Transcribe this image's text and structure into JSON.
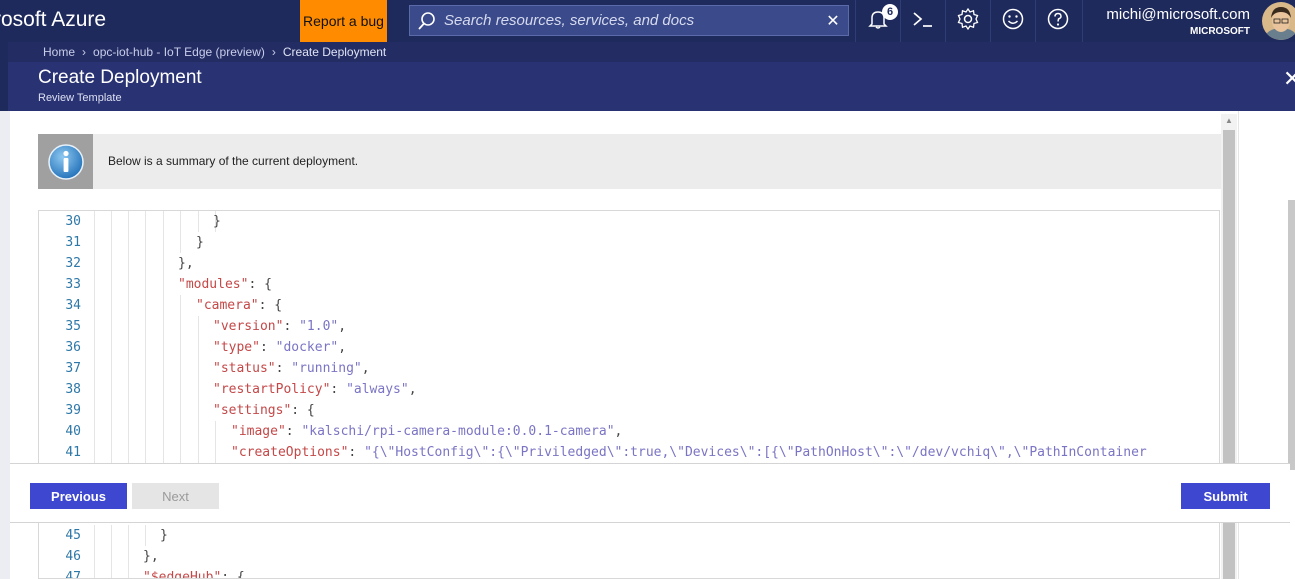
{
  "header": {
    "brand": "rosoft Azure",
    "report_bug": "Report a bug",
    "search_placeholder": "Search resources, services, and docs",
    "notifications_count": "6",
    "account_name": "michi@microsoft.com",
    "account_tenant": "MICROSOFT",
    "icons": [
      "bell-icon",
      "cloud-shell-icon",
      "gear-icon",
      "smiley-icon",
      "help-icon"
    ]
  },
  "breadcrumb": {
    "home": "Home",
    "hub": "opc-iot-hub - IoT Edge (preview)",
    "current": "Create Deployment"
  },
  "blade": {
    "title": "Create Deployment",
    "subtitle": "Review Template",
    "close": "✕"
  },
  "info": {
    "text": "Below is a summary of the current deployment."
  },
  "editor": {
    "lines": [
      {
        "n": "30",
        "parts": [
          [
            "p",
            "}"
          ]
        ]
      },
      {
        "n": "31",
        "parts": [
          [
            "p",
            "}"
          ]
        ]
      },
      {
        "n": "32",
        "parts": [
          [
            "p",
            "},"
          ]
        ]
      },
      {
        "n": "33",
        "parts": [
          [
            "k",
            "\"modules\""
          ],
          [
            "p",
            ": {"
          ]
        ]
      },
      {
        "n": "34",
        "parts": [
          [
            "k",
            "\"camera\""
          ],
          [
            "p",
            ": {"
          ]
        ]
      },
      {
        "n": "35",
        "parts": [
          [
            "k",
            "\"version\""
          ],
          [
            "p",
            ": "
          ],
          [
            "s",
            "\"1.0\""
          ],
          [
            "p",
            ","
          ]
        ]
      },
      {
        "n": "36",
        "parts": [
          [
            "k",
            "\"type\""
          ],
          [
            "p",
            ": "
          ],
          [
            "s",
            "\"docker\""
          ],
          [
            "p",
            ","
          ]
        ]
      },
      {
        "n": "37",
        "parts": [
          [
            "k",
            "\"status\""
          ],
          [
            "p",
            ": "
          ],
          [
            "s",
            "\"running\""
          ],
          [
            "p",
            ","
          ]
        ]
      },
      {
        "n": "38",
        "parts": [
          [
            "k",
            "\"restartPolicy\""
          ],
          [
            "p",
            ": "
          ],
          [
            "s",
            "\"always\""
          ],
          [
            "p",
            ","
          ]
        ]
      },
      {
        "n": "39",
        "parts": [
          [
            "k",
            "\"settings\""
          ],
          [
            "p",
            ": {"
          ]
        ]
      },
      {
        "n": "40",
        "parts": [
          [
            "k",
            "\"image\""
          ],
          [
            "p",
            ": "
          ],
          [
            "s",
            "\"kalschi/rpi-camera-module:0.0.1-camera\""
          ],
          [
            "p",
            ","
          ]
        ]
      },
      {
        "n": "41",
        "parts": [
          [
            "k",
            "\"createOptions\""
          ],
          [
            "p",
            ": "
          ],
          [
            "s",
            "\"{\\\"HostConfig\\\":{\\\"Priviledged\\\":true,\\\"Devices\\\":[{\\\"PathOnHost\\\":\\\"/dev/vchiq\\\",\\\"PathInContainer"
          ]
        ]
      }
    ],
    "lines_lower": [
      {
        "n": "45",
        "parts": [
          [
            "p",
            "}"
          ]
        ]
      },
      {
        "n": "46",
        "parts": [
          [
            "p",
            "},"
          ]
        ]
      },
      {
        "n": "47",
        "parts": [
          [
            "k",
            "\"$edgeHub\""
          ],
          [
            "p",
            ": {"
          ]
        ]
      }
    ]
  },
  "wizard": {
    "previous": "Previous",
    "next": "Next",
    "submit": "Submit"
  }
}
